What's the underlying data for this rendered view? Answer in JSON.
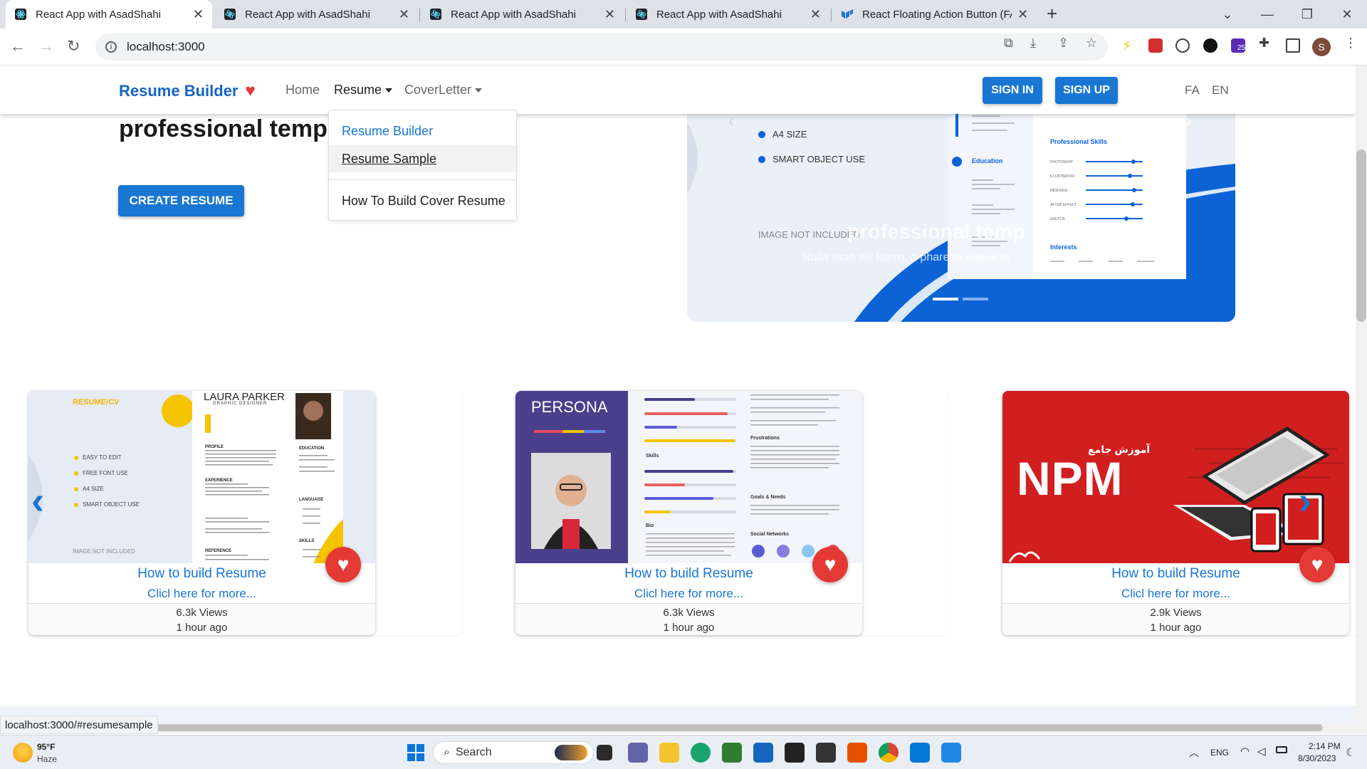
{
  "browser": {
    "tabs": [
      {
        "title": "React App with AsadShahi",
        "active": true
      },
      {
        "title": "React App with AsadShahi",
        "active": false
      },
      {
        "title": "React App with AsadShahi",
        "active": false
      },
      {
        "title": "React App with AsadShahi",
        "active": false
      },
      {
        "title": "React Floating Action Button (FAB)",
        "active": false
      }
    ],
    "new_tab": "+",
    "url": "localhost:3000",
    "profile_initial": "S",
    "extension_badge": "25",
    "status_url": "localhost:3000/#resumesample"
  },
  "navbar": {
    "brand": "Resume Builder",
    "brand_heart": "♥",
    "links": {
      "home": "Home",
      "resume": "Resume",
      "coverletter": "CoverLetter"
    },
    "sign_in": "SIGN IN",
    "sign_up": "SIGN UP",
    "lang_fa": "FA",
    "lang_en": "EN"
  },
  "dropdown": {
    "items": [
      "Resume Builder",
      "Resume Sample",
      "How To Build Cover Resume"
    ]
  },
  "hero": {
    "heading": "professional templat",
    "create_button": "CREATE RESUME",
    "carousel": {
      "features": [
        "A4 SIZE",
        "SMART OBJECT USE"
      ],
      "image_note": "IMAGE NOT INCLUDED",
      "caption_title": "professional temp",
      "caption_text": "Nulla vitae elit libero, a pharetra augue m",
      "resume_sections": {
        "education": "Education",
        "skills": "Professional Skills",
        "interests": "Interests"
      },
      "skill_names": [
        "PHOTOSHOP",
        "ILLUSTRATOR",
        "INDESIGN",
        "AFTER EFFECT",
        "SKETCH"
      ]
    }
  },
  "cards": [
    {
      "title": "How to build Resume",
      "link": "Clicl here for more...",
      "views": "6.3k Views",
      "time": "1 hour ago",
      "thumb": {
        "logo": "RESUME/CV",
        "name": "LAURA PARKER",
        "role": "GRAPHIC DESIGNER",
        "bullets": [
          "EASY TO EDIT",
          "FREE FONT USE",
          "A4 SIZE",
          "SMART OBJECT USE"
        ],
        "note": "IMAGE NOT INCLUDED",
        "sections": [
          "PROFILE",
          "EDUCATION",
          "EXPERIENCE",
          "LANGUAGE",
          "REFERENCE",
          "SKILLS"
        ]
      }
    },
    {
      "title": "How to build Resume",
      "link": "Clicl here for more...",
      "views": "6.3k Views",
      "time": "1 hour ago",
      "thumb": {
        "heading": "PERSONA",
        "sections": [
          "Skills",
          "Frustrations",
          "Goals & Needs",
          "Bio",
          "Social Networks"
        ]
      }
    },
    {
      "title": "How to build Resume",
      "link": "Clicl here for more...",
      "views": "2.9k Views",
      "time": "1 hour ago",
      "thumb": {
        "heading": "NPM",
        "subtitle": "آموزش جامع"
      }
    }
  ],
  "taskbar": {
    "temperature": "95°F",
    "weather": "Haze",
    "search": "Search",
    "language": "ENG",
    "time": "2:14 PM",
    "date": "8/30/2023"
  },
  "colors": {
    "accent": "#1976d2",
    "heart": "#e53935",
    "npm_red": "#d11f1f",
    "persona_purple": "#4a3f8a"
  }
}
